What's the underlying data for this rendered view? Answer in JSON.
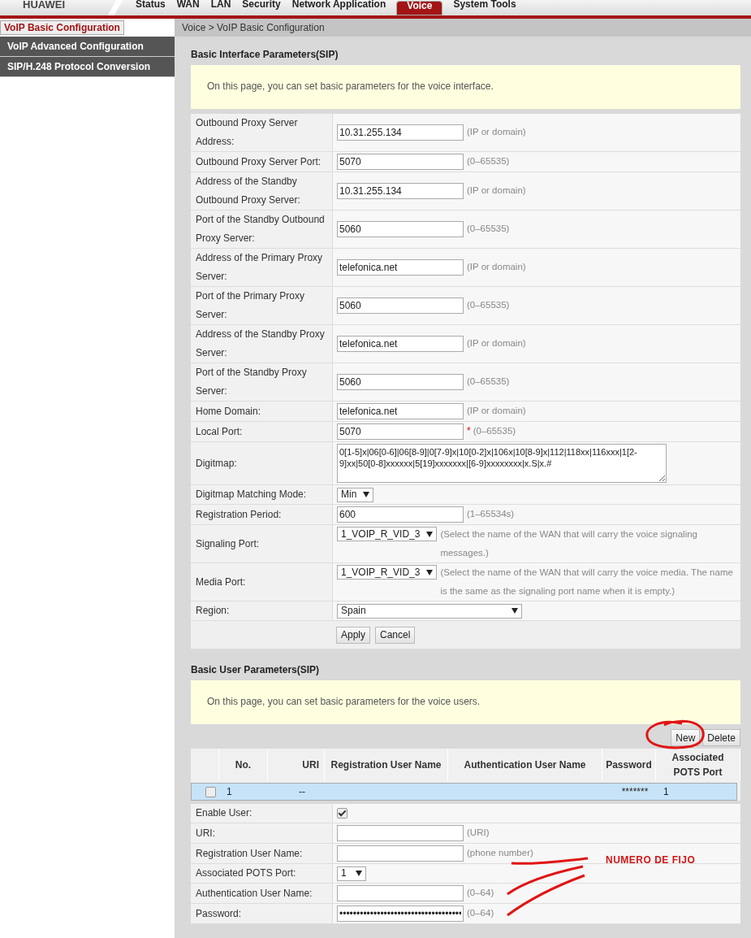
{
  "brand": "HUAWEI",
  "nav_tabs": [
    {
      "label": "Status",
      "selected": false
    },
    {
      "label": "WAN",
      "selected": false
    },
    {
      "label": "LAN",
      "selected": false
    },
    {
      "label": "Security",
      "selected": false
    },
    {
      "label": "Network Application",
      "selected": false
    },
    {
      "label": "Voice",
      "selected": true
    },
    {
      "label": "System Tools",
      "selected": false
    }
  ],
  "sidebar": {
    "items": [
      {
        "label": "VoIP Basic Configuration",
        "selected": true
      },
      {
        "label": "VoIP Advanced Configuration",
        "selected": false
      },
      {
        "label": "SIP/H.248 Protocol Conversion",
        "selected": false
      }
    ]
  },
  "breadcrumb": "Voice > VoIP Basic Configuration",
  "interface_section": {
    "title": "Basic Interface Parameters(SIP)",
    "info": "On this page, you can set basic parameters for the voice interface.",
    "fields": [
      {
        "kind": "text",
        "label": "Outbound Proxy Server Address:",
        "value": "10.31.255.134",
        "hint": "(IP or domain)"
      },
      {
        "kind": "text",
        "label": "Outbound Proxy Server Port:",
        "value": "5070",
        "hint": "(0–65535)"
      },
      {
        "kind": "text",
        "label": "Address of the Standby Outbound Proxy Server:",
        "value": "10.31.255.134",
        "hint": "(IP or domain)"
      },
      {
        "kind": "text",
        "label": "Port of the Standby Outbound Proxy Server:",
        "value": "5060",
        "hint": "(0–65535)"
      },
      {
        "kind": "text",
        "label": "Address of the Primary Proxy Server:",
        "value": "telefonica.net",
        "hint": "(IP or domain)"
      },
      {
        "kind": "text",
        "label": "Port of the Primary Proxy Server:",
        "value": "5060",
        "hint": "(0–65535)"
      },
      {
        "kind": "text",
        "label": "Address of the Standby Proxy Server:",
        "value": "telefonica.net",
        "hint": "(IP or domain)"
      },
      {
        "kind": "text",
        "label": "Port of the Standby Proxy Server:",
        "value": "5060",
        "hint": "(0–65535)"
      },
      {
        "kind": "text",
        "label": "Home Domain:",
        "value": "telefonica.net",
        "hint": "(IP or domain)"
      },
      {
        "kind": "text",
        "label": "Local Port:",
        "value": "5070",
        "mark": "*",
        "hint": "(0–65535)"
      },
      {
        "kind": "textarea",
        "label": "Digitmap:",
        "value": "0[1-5]x|06[0-6]|06[8-9]|0[7-9]x|10[0-2]x|106x|10[8-9]x|112|118xx|116xxx|1[2-9]xx|50[0-8]xxxxxx|5[19]xxxxxxx|[6-9]xxxxxxxx|x.S|x.#"
      },
      {
        "kind": "select",
        "label": "Digitmap Matching Mode:",
        "value": "Min"
      },
      {
        "kind": "text",
        "label": "Registration Period:",
        "value": "600",
        "hint": "(1–65534s)"
      },
      {
        "kind": "select",
        "label": "Signaling Port:",
        "value": "1_VOIP_R_VID_3",
        "hint": "(Select the name of the WAN that will carry the voice signaling messages.)"
      },
      {
        "kind": "select",
        "label": "Media Port:",
        "value": "1_VOIP_R_VID_3",
        "hint": "(Select the name of the WAN that will carry the voice media. The name is the same as the signaling port name when it is empty.)"
      },
      {
        "kind": "wide-select",
        "label": "Region:",
        "value": "Spain"
      }
    ],
    "buttons": [
      "Apply",
      "Cancel"
    ]
  },
  "user_section": {
    "title": "Basic User Parameters(SIP)",
    "info": "On this page, you can set basic parameters for the voice users.",
    "buttons": [
      "New",
      "Delete"
    ],
    "table": {
      "columns": [
        "No.",
        "URI",
        "Registration User Name",
        "Authentication User Name",
        "Password",
        "Associated POTS Port"
      ],
      "rows": [
        {
          "selected": true,
          "checked": false,
          "no": "1",
          "uri": "--",
          "password": "*******",
          "port": "1"
        }
      ]
    },
    "fields": [
      {
        "kind": "checkbox",
        "label": "Enable User:",
        "checked": true
      },
      {
        "kind": "text",
        "label": "URI:",
        "hint": "(URI)"
      },
      {
        "kind": "text",
        "label": "Registration User Name:",
        "hint": "(phone number)"
      },
      {
        "kind": "select",
        "label": "Associated POTS Port:",
        "value": "1"
      },
      {
        "kind": "text",
        "label": "Authentication User Name:",
        "hint": "(0–64)"
      },
      {
        "kind": "text",
        "label": "Password:",
        "value": "••••••••••••••••••••••••••••••••••••",
        "hint": "(0–64)"
      }
    ]
  },
  "annotation": {
    "text": "NUMERO DE FIJO"
  }
}
